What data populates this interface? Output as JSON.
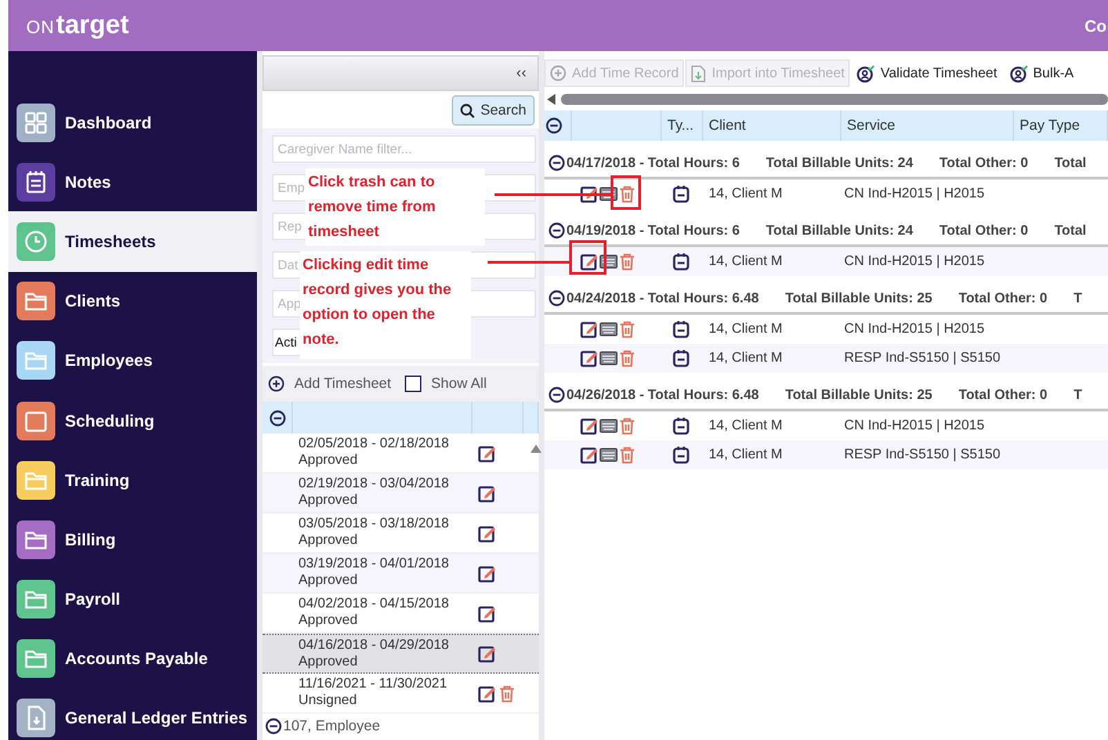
{
  "header": {
    "logo_prefix": "ON",
    "logo_name": "target",
    "right_text": "Co"
  },
  "sidebar": {
    "items": [
      {
        "label": "Dashboard",
        "kind": "grid",
        "color": "#9fb1c4",
        "selected": false
      },
      {
        "label": "Notes",
        "kind": "notepad",
        "color": "#5a3d9e",
        "selected": false
      },
      {
        "label": "Timesheets",
        "kind": "clock",
        "color": "#5fc38e",
        "selected": true
      },
      {
        "label": "Clients",
        "kind": "folder",
        "color": "#e27a5c",
        "selected": false
      },
      {
        "label": "Employees",
        "kind": "folder",
        "color": "#a9d6f2",
        "selected": false
      },
      {
        "label": "Scheduling",
        "kind": "calendar",
        "color": "#e27a5c",
        "selected": false
      },
      {
        "label": "Training",
        "kind": "folder",
        "color": "#f6cd5e",
        "selected": false
      },
      {
        "label": "Billing",
        "kind": "folder",
        "color": "#a46cc2",
        "selected": false
      },
      {
        "label": "Payroll",
        "kind": "folder",
        "color": "#5fc38e",
        "selected": false
      },
      {
        "label": "Accounts Payable",
        "kind": "folder",
        "color": "#5fc38e",
        "selected": false
      },
      {
        "label": "General Ledger Entries",
        "kind": "document",
        "color": "#a3b3c3",
        "selected": false
      }
    ]
  },
  "timesheet_panel": {
    "collapse": "‹‹",
    "search_button": "Search",
    "filters": [
      {
        "kind": "input",
        "placeholder": "Caregiver Name filter..."
      },
      {
        "kind": "input",
        "placeholder": "Emp"
      },
      {
        "kind": "input",
        "placeholder": "Rep"
      },
      {
        "kind": "input",
        "placeholder": "Dat"
      },
      {
        "kind": "input",
        "placeholder": "App"
      },
      {
        "kind": "select",
        "value": "Acti"
      }
    ],
    "add_timesheet": "Add Timesheet",
    "show_all": {
      "label": "Show All",
      "checked": false
    },
    "rows": [
      {
        "period": "02/05/2018 - 02/18/2018",
        "status": "Approved",
        "selected": false,
        "deletable": false
      },
      {
        "period": "02/19/2018 - 03/04/2018",
        "status": "Approved",
        "selected": false,
        "deletable": false
      },
      {
        "period": "03/05/2018 - 03/18/2018",
        "status": "Approved",
        "selected": false,
        "deletable": false
      },
      {
        "period": "03/19/2018 - 04/01/2018",
        "status": "Approved",
        "selected": false,
        "deletable": false
      },
      {
        "period": "04/02/2018 - 04/15/2018",
        "status": "Approved",
        "selected": false,
        "deletable": false
      },
      {
        "period": "04/16/2018 - 04/29/2018",
        "status": "Approved",
        "selected": true,
        "deletable": false
      },
      {
        "period": "11/16/2021 - 11/30/2021",
        "status": "Unsigned",
        "selected": false,
        "deletable": true
      }
    ],
    "next_group": "107, Employee"
  },
  "records_panel": {
    "toolbar": [
      {
        "label": "Add Time Record",
        "kind": "add",
        "disabled": true
      },
      {
        "label": "Import into Timesheet",
        "kind": "import",
        "disabled": true
      },
      {
        "label": "Validate Timesheet",
        "kind": "validate",
        "disabled": false
      },
      {
        "label": "Bulk-A",
        "kind": "validate",
        "disabled": false
      }
    ],
    "columns": [
      "Ty...",
      "Client",
      "Service",
      "Pay Type"
    ],
    "groups": [
      {
        "date": "04/17/2018 - Total Hours: 6",
        "billable": "Total Billable Units: 24",
        "other": "Total Other: 0",
        "more": "Total",
        "records": [
          {
            "client": "14, Client M",
            "service": "CN Ind-H2015 | H2015"
          }
        ]
      },
      {
        "date": "04/19/2018 - Total Hours: 6",
        "billable": "Total Billable Units: 24",
        "other": "Total Other: 0",
        "more": "Total",
        "records": [
          {
            "client": "14, Client M",
            "service": "CN Ind-H2015 | H2015"
          }
        ]
      },
      {
        "date": "04/24/2018 - Total Hours: 6.48",
        "billable": "Total Billable Units: 25",
        "other": "Total Other: 0",
        "more": "T",
        "records": [
          {
            "client": "14, Client M",
            "service": "CN Ind-H2015 | H2015"
          },
          {
            "client": "14, Client M",
            "service": "RESP Ind-S5150 | S5150"
          }
        ]
      },
      {
        "date": "04/26/2018 - Total Hours: 6.48",
        "billable": "Total Billable Units: 25",
        "other": "Total Other: 0",
        "more": "T",
        "records": [
          {
            "client": "14, Client M",
            "service": "CN Ind-H2015 | H2015"
          },
          {
            "client": "14, Client M",
            "service": "RESP Ind-S5150 | S5150"
          }
        ]
      }
    ]
  },
  "callouts": [
    {
      "text": "Click trash can to remove time from timesheet"
    },
    {
      "text": "Clicking edit time record gives you the option to open the note."
    }
  ]
}
